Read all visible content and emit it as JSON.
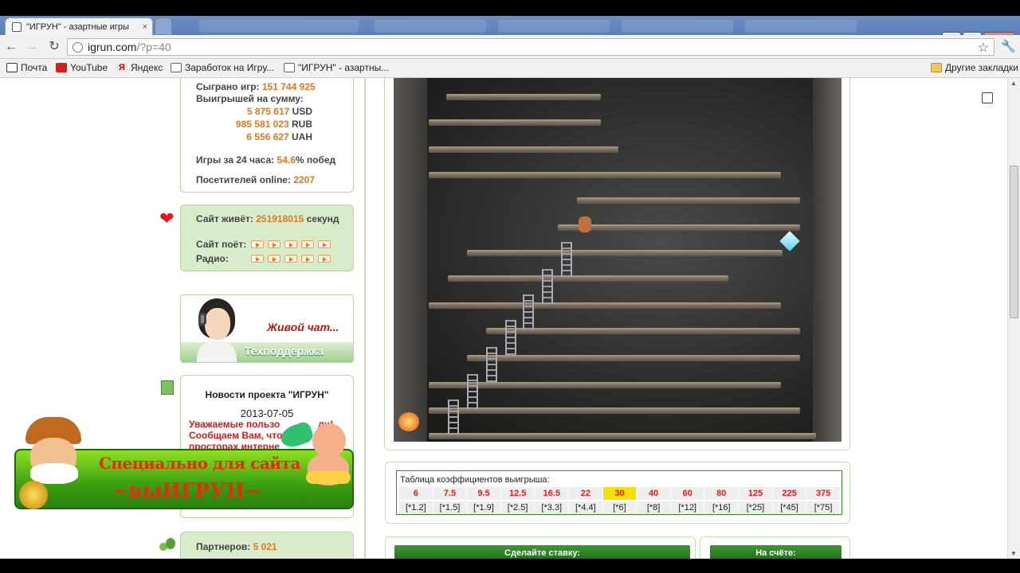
{
  "browser": {
    "tab_title": "\"ИГРУН\" - азартные игры",
    "url_host": "igrun.com",
    "url_path": "/?p=40",
    "bookmarks": [
      {
        "label": "Почта",
        "icon": "mail-icon"
      },
      {
        "label": "YouTube",
        "icon": "youtube-icon"
      },
      {
        "label": "Яндекс",
        "icon": "yandex-icon"
      },
      {
        "label": "Заработок на Игру...",
        "icon": "page-icon"
      },
      {
        "label": "\"ИГРУН\" - азартны...",
        "icon": "page-icon"
      }
    ],
    "other_bookmarks": "Другие закладки"
  },
  "stats": {
    "games_played_label": "Сыграно игр:",
    "games_played": "151 744 925",
    "wins_label": "Выигрышей на сумму:",
    "wins": [
      {
        "amount": "5 875 617",
        "currency": "USD"
      },
      {
        "amount": "985 581 023",
        "currency": "RUB"
      },
      {
        "amount": "6 556 627",
        "currency": "UAH"
      }
    ],
    "day_games_label": "Игры за 24 часа:",
    "day_games_pct": "54.6",
    "day_games_suffix": "% побед",
    "online_label": "Посетителей online:",
    "online": "2207"
  },
  "site": {
    "alive_label": "Сайт живёт:",
    "alive_seconds": "251918015",
    "alive_suffix": "секунд",
    "sings_label": "Сайт поёт:",
    "radio_label": "Радио:"
  },
  "chat_banner": {
    "title": "Живой чат...",
    "subtitle": "Техподдержка"
  },
  "news": {
    "title": "Новости проекта \"ИГРУН\"",
    "date": "2013-07-05",
    "lines": [
      "Уважаемые пользо",
      "Сообщаем Вам, что",
      "просторах интерне"
    ],
    "line_tails": [
      "ли!",
      "",
      ""
    ]
  },
  "promo": {
    "line1": "Специально для сайта",
    "line2": "~выИГРУН~"
  },
  "partners": {
    "label": "Партнеров:",
    "value": "5 021"
  },
  "coef_table": {
    "title": "Таблица коэффициентов выигрыша:",
    "highlight_index": 6,
    "top": [
      "6",
      "7.5",
      "9.5",
      "12.5",
      "16.5",
      "22",
      "30",
      "40",
      "60",
      "80",
      "125",
      "225",
      "375"
    ],
    "bottom": [
      "[*1.2]",
      "[*1.5]",
      "[*1.9]",
      "[*2.5]",
      "[*3.3]",
      "[*4.4]",
      "[*6]",
      "[*8]",
      "[*12]",
      "[*16]",
      "[*25]",
      "[*45]",
      "[*75]"
    ]
  },
  "bet": {
    "place_label": "Сделайте ставку:",
    "balance_label": "На счёте:"
  }
}
